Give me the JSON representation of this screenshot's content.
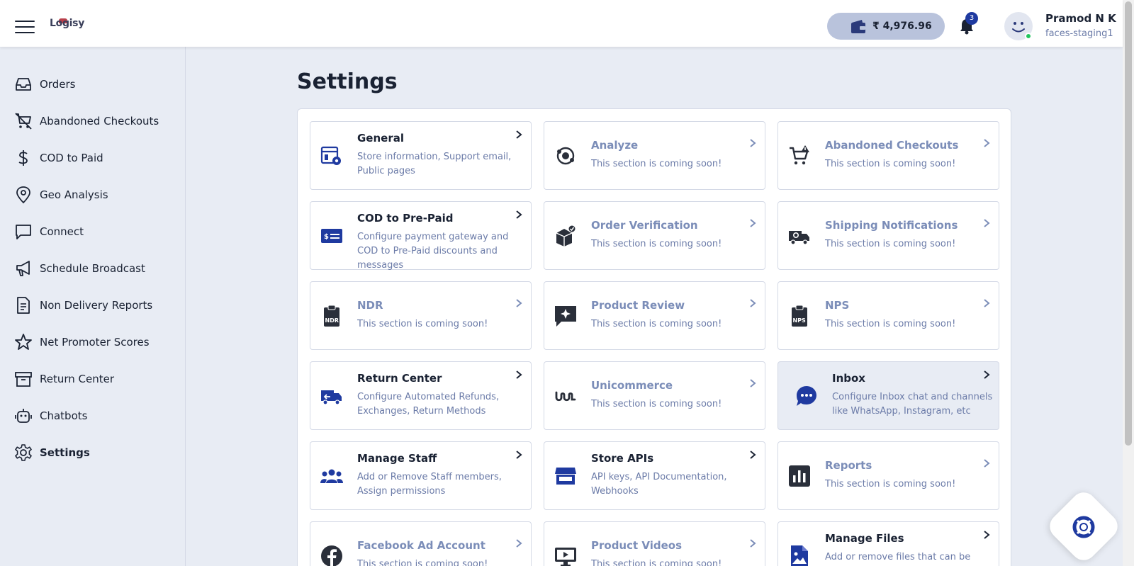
{
  "header": {
    "logo_text": "Logisy",
    "wallet_amount": "₹ 4,976.96",
    "notification_count": "3",
    "user_name": "Pramod N K",
    "user_store": "faces-staging1"
  },
  "sidebar": {
    "items": [
      {
        "label": "Orders",
        "icon": "inbox-tray-icon"
      },
      {
        "label": "Abandoned Checkouts",
        "icon": "cart-off-icon"
      },
      {
        "label": "COD to Paid",
        "icon": "dollar-icon"
      },
      {
        "label": "Geo Analysis",
        "icon": "map-pin-icon"
      },
      {
        "label": "Connect",
        "icon": "chat-bubble-icon"
      },
      {
        "label": "Schedule Broadcast",
        "icon": "megaphone-icon"
      },
      {
        "label": "Non Delivery Reports",
        "icon": "document-icon"
      },
      {
        "label": "Net Promoter Scores",
        "icon": "star-icon"
      },
      {
        "label": "Return Center",
        "icon": "archive-box-icon"
      },
      {
        "label": "Chatbots",
        "icon": "robot-icon"
      },
      {
        "label": "Settings",
        "icon": "gear-icon",
        "active": true
      }
    ]
  },
  "page": {
    "title": "Settings"
  },
  "cards": [
    {
      "title": "General",
      "desc": "Store information, Support email, Public pages",
      "icon": "store-settings-icon",
      "soon": false
    },
    {
      "title": "Analyze",
      "desc": "This section is coming soon!",
      "icon": "analyze-icon",
      "soon": true
    },
    {
      "title": "Abandoned Checkouts",
      "desc": "This section is coming soon!",
      "icon": "cart-alert-icon",
      "soon": true
    },
    {
      "title": "COD to Pre-Paid",
      "desc": "Configure payment gateway and COD to Pre-Paid discounts and messages",
      "icon": "payment-card-icon",
      "soon": false
    },
    {
      "title": "Order Verification",
      "desc": "This section is coming soon!",
      "icon": "box-check-icon",
      "soon": true
    },
    {
      "title": "Shipping Notifications",
      "desc": "This section is coming soon!",
      "icon": "truck-chat-icon",
      "soon": true
    },
    {
      "title": "NDR",
      "desc": "This section is coming soon!",
      "icon": "ndr-clipboard-icon",
      "soon": true
    },
    {
      "title": "Product Review",
      "desc": "This section is coming soon!",
      "icon": "review-sparkle-icon",
      "soon": true
    },
    {
      "title": "NPS",
      "desc": "This section is coming soon!",
      "icon": "nps-clipboard-icon",
      "soon": true
    },
    {
      "title": "Return Center",
      "desc": "Configure Automated Refunds, Exchanges, Return Methods",
      "icon": "return-truck-icon",
      "soon": false
    },
    {
      "title": "Unicommerce",
      "desc": "This section is coming soon!",
      "icon": "unicommerce-icon",
      "soon": true
    },
    {
      "title": "Inbox",
      "desc": "Configure Inbox chat and channels like WhatsApp, Instagram, etc",
      "icon": "chat-dots-icon",
      "soon": false,
      "highlight": true
    },
    {
      "title": "Manage Staff",
      "desc": "Add or Remove Staff members, Assign permissions",
      "icon": "users-icon",
      "soon": false
    },
    {
      "title": "Store APIs",
      "desc": "API keys, API Documentation, Webhooks",
      "icon": "storefront-icon",
      "soon": false
    },
    {
      "title": "Reports",
      "desc": "This section is coming soon!",
      "icon": "bar-chart-icon",
      "soon": true
    },
    {
      "title": "Facebook Ad Account",
      "desc": "This section is coming soon!",
      "icon": "facebook-icon",
      "soon": true
    },
    {
      "title": "Product Videos",
      "desc": "This section is coming soon!",
      "icon": "monitor-video-icon",
      "soon": true
    },
    {
      "title": "Manage Files",
      "desc": "Add or remove files that can be used in",
      "icon": "file-image-icon",
      "soon": false
    }
  ],
  "colors": {
    "accent": "#1f3aa0",
    "muted_text": "#6b7ba8",
    "soon_title": "#7b8db8",
    "page_bg": "#e8ecf4"
  }
}
